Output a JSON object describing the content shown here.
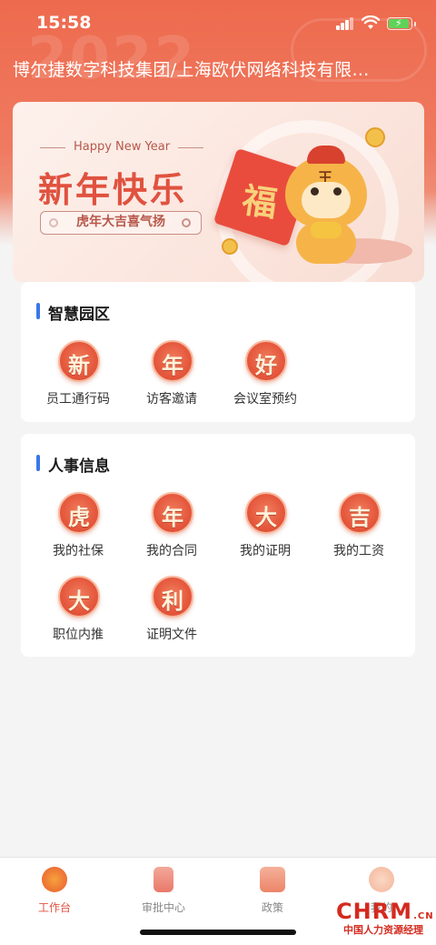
{
  "status_bar": {
    "time": "15:58"
  },
  "header": {
    "company": "博尔捷数字科技集团/上海欧伏网络科技有限…",
    "decor_year": "2022"
  },
  "banner": {
    "subtitle_en": "Happy New Year",
    "title": "新年快乐",
    "slogan": "虎年大吉喜气扬",
    "fu_char": "福",
    "tiger_mark": "王"
  },
  "sections": [
    {
      "title": "智慧园区",
      "items": [
        {
          "char": "新",
          "label": "员工通行码"
        },
        {
          "char": "年",
          "label": "访客邀请"
        },
        {
          "char": "好",
          "label": "会议室预约"
        }
      ]
    },
    {
      "title": "人事信息",
      "items": [
        {
          "char": "虎",
          "label": "我的社保"
        },
        {
          "char": "年",
          "label": "我的合同"
        },
        {
          "char": "大",
          "label": "我的证明"
        },
        {
          "char": "吉",
          "label": "我的工资"
        },
        {
          "char": "大",
          "label": "职位内推"
        },
        {
          "char": "利",
          "label": "证明文件"
        }
      ]
    }
  ],
  "tabbar": {
    "tabs": [
      {
        "label": "工作台",
        "icon": "home-2022-icon",
        "active": true
      },
      {
        "label": "审批中心",
        "icon": "approval-envelope-icon",
        "active": false
      },
      {
        "label": "政策",
        "icon": "policy-fa-icon",
        "active": false
      },
      {
        "label": "我的",
        "icon": "tiger-avatar-icon",
        "active": false
      }
    ]
  },
  "watermark": {
    "main": "CHRM",
    "suffix": ".CN",
    "sub": "中国人力资源经理"
  },
  "colors": {
    "accent": "#e0523f",
    "section_bar": "#3b78e7",
    "header": "#ee6a4e"
  }
}
